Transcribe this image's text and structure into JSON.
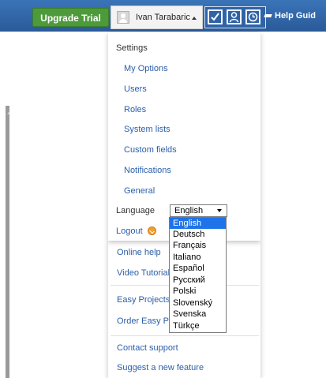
{
  "header": {
    "upgrade_label": "Upgrade Trial",
    "user_name": "Ivan Tarabaric",
    "help_label": "Help Guid",
    "icons": [
      "check-icon",
      "person-icon",
      "clock-icon",
      "graduation-cap-icon"
    ]
  },
  "settings_menu": {
    "heading": "Settings",
    "items": [
      "My Options",
      "Users",
      "Roles",
      "System lists",
      "Custom fields",
      "Notifications",
      "General"
    ],
    "language_label": "Language",
    "language_value": "English",
    "logout_label": "Logout"
  },
  "language_options": [
    "English",
    "Deutsch",
    "Français",
    "Italiano",
    "Español",
    "Русский",
    "Polski",
    "Slovenský",
    "Svenska",
    "Türkçe"
  ],
  "background_menu": {
    "items": [
      "Online help",
      "Video Tutorials",
      "Easy Projects",
      "Order Easy Pr",
      "Contact support",
      "Suggest a new feature"
    ],
    "behind_link": "ts"
  },
  "colors": {
    "header_bg": "#2f63a6",
    "upgrade_bg": "#4d9a3a",
    "link": "#2b5ea8",
    "selected_option": "#1e73e8"
  }
}
